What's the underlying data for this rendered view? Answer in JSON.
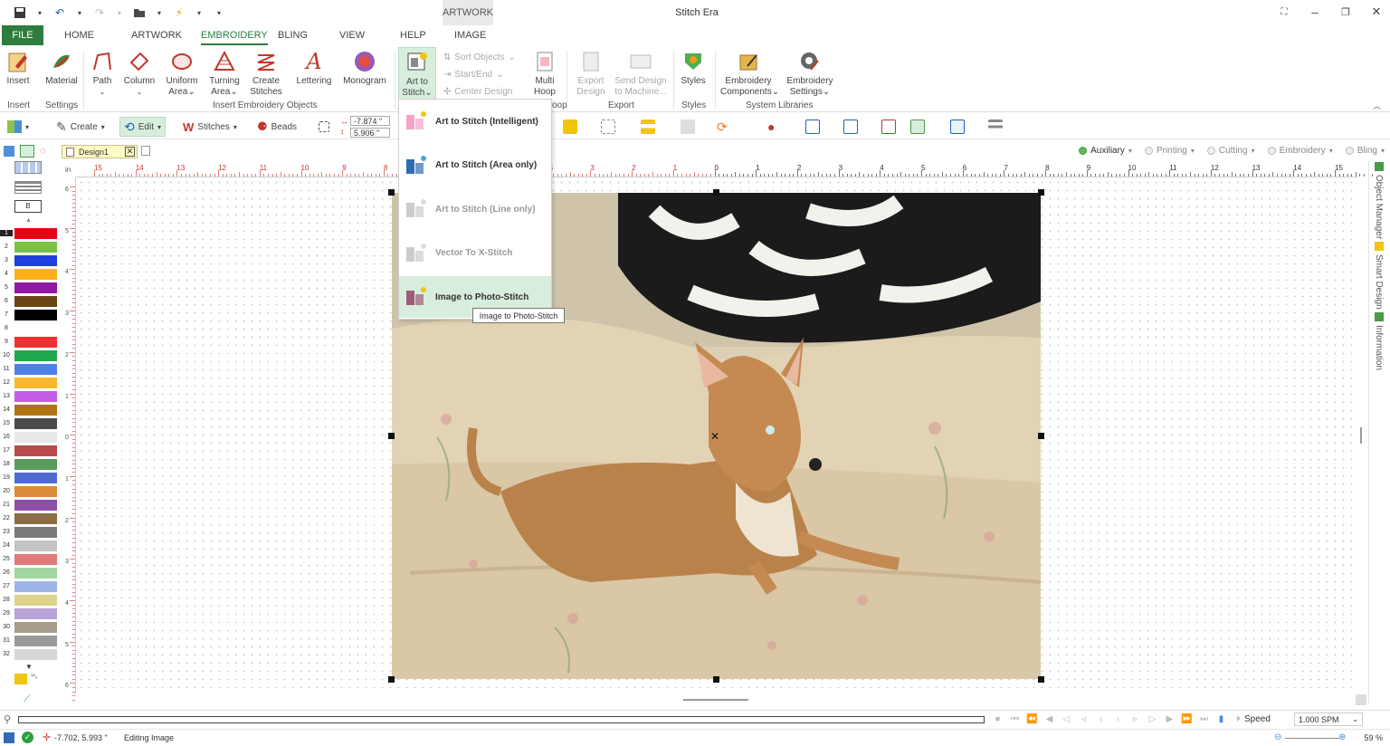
{
  "app": {
    "title": "Stitch Era",
    "context_tab": "ARTWORK"
  },
  "tabs": [
    {
      "id": "file",
      "label": "FILE"
    },
    {
      "id": "home",
      "label": "HOME"
    },
    {
      "id": "artwork",
      "label": "ARTWORK"
    },
    {
      "id": "embroidery",
      "label": "EMBROIDERY"
    },
    {
      "id": "bling",
      "label": "BLING"
    },
    {
      "id": "view",
      "label": "VIEW"
    },
    {
      "id": "help",
      "label": "HELP"
    },
    {
      "id": "image",
      "label": "IMAGE"
    }
  ],
  "ribbon": {
    "insert": "Insert",
    "material": "Material",
    "path": "Path",
    "column": "Column",
    "uniform": "Uniform",
    "uniform2": "Area",
    "turning": "Turning",
    "turning2": "Area",
    "create": "Create",
    "create2": "Stitches",
    "lettering": "Lettering",
    "monogram": "Monogram",
    "art": "Art to",
    "art2": "Stitch",
    "sort": "Sort Objects",
    "startend": "Start/End",
    "center": "Center Design",
    "multi": "Multi",
    "multi2": "Hoop",
    "export": "Export",
    "export2": "Design",
    "send": "Send Design",
    "send2": "to Machine...",
    "styles": "Styles",
    "components": "Embroidery",
    "components2": "Components",
    "settings": "Embroidery",
    "settings2": "Settings"
  },
  "groups": {
    "insert": "Insert",
    "settings": "Settings",
    "objects": "Insert Embroidery Objects",
    "hoop": "oop",
    "export": "Export",
    "styles": "Styles",
    "libraries": "System Libraries"
  },
  "toolbar": {
    "create": "Create",
    "edit": "Edit",
    "stitches": "Stitches",
    "beads": "Beads",
    "x_value": "-7.874 \"",
    "y_value": "5.906 \""
  },
  "document": {
    "tab": "Design1",
    "close": "✕"
  },
  "layers": [
    {
      "label": "Auxiliary",
      "on": true
    },
    {
      "label": "Printing",
      "on": false
    },
    {
      "label": "Cutting",
      "on": false
    },
    {
      "label": "Embroidery",
      "on": false
    },
    {
      "label": "Bling",
      "on": false
    }
  ],
  "ruler": {
    "unit": "in",
    "top_ticks": [
      "15",
      "14",
      "13",
      "12",
      "11",
      "10",
      "9",
      "8",
      "7",
      "6",
      "5",
      "4",
      "3",
      "2",
      "1",
      "0",
      "1",
      "2",
      "3",
      "4",
      "5",
      "6",
      "7",
      "8",
      "9",
      "10",
      "11",
      "12",
      "13",
      "14",
      "15"
    ],
    "left_ticks": [
      "6",
      "5",
      "4",
      "3",
      "2",
      "1",
      "0",
      "1",
      "2",
      "3",
      "4",
      "5",
      "6"
    ]
  },
  "palette": [
    {
      "n": "1",
      "c": "#e30613"
    },
    {
      "n": "2",
      "c": "#7cc242"
    },
    {
      "n": "3",
      "c": "#1d3fe0"
    },
    {
      "n": "4",
      "c": "#fbb117"
    },
    {
      "n": "5",
      "c": "#8e1aa3"
    },
    {
      "n": "6",
      "c": "#6a4416"
    },
    {
      "n": "7",
      "c": "#000000"
    },
    {
      "n": "8",
      "c": "#ffffff"
    },
    {
      "n": "9",
      "c": "#f23033"
    },
    {
      "n": "10",
      "c": "#1fa84d"
    },
    {
      "n": "11",
      "c": "#4f7fe8"
    },
    {
      "n": "12",
      "c": "#fbb72b"
    },
    {
      "n": "13",
      "c": "#c55ce5"
    },
    {
      "n": "14",
      "c": "#b17414"
    },
    {
      "n": "15",
      "c": "#4b4b4b"
    },
    {
      "n": "16",
      "c": "#e8e8e8"
    },
    {
      "n": "17",
      "c": "#b84b4b"
    },
    {
      "n": "18",
      "c": "#5a9a5a"
    },
    {
      "n": "19",
      "c": "#4f6bd0"
    },
    {
      "n": "20",
      "c": "#db8a3a"
    },
    {
      "n": "21",
      "c": "#8b4fa8"
    },
    {
      "n": "22",
      "c": "#8b6d47"
    },
    {
      "n": "23",
      "c": "#7a7a7a"
    },
    {
      "n": "24",
      "c": "#c4c4c4"
    },
    {
      "n": "25",
      "c": "#e07a7a"
    },
    {
      "n": "26",
      "c": "#a0d6a0"
    },
    {
      "n": "27",
      "c": "#9fb4e8"
    },
    {
      "n": "28",
      "c": "#ded38a"
    },
    {
      "n": "29",
      "c": "#b7a3d6"
    },
    {
      "n": "30",
      "c": "#a69c8a"
    },
    {
      "n": "31",
      "c": "#9a9a9a"
    },
    {
      "n": "32",
      "c": "#d6d6d6"
    }
  ],
  "dropdown": [
    {
      "label": "Art to Stitch (Intelligent)",
      "disabled": false,
      "hover": false
    },
    {
      "label": "Art to Stitch (Area only)",
      "disabled": false,
      "hover": false
    },
    {
      "label": "Art to Stitch (Line only)",
      "disabled": true,
      "hover": false
    },
    {
      "label": "Vector To X-Stitch",
      "disabled": true,
      "hover": false
    },
    {
      "label": "Image to Photo-Stitch",
      "disabled": false,
      "hover": true
    }
  ],
  "tooltip": "Image to Photo-Stitch",
  "side_tabs": {
    "object_manager": "Object Manager",
    "smart_design": "Smart Design",
    "information": "Information"
  },
  "bottom": {
    "speed_label": "Speed",
    "speed_value": "1.000 SPM"
  },
  "status": {
    "coords": "-7.702, 5.993 \"",
    "message": "Editing Image",
    "zoom": "59 %"
  }
}
